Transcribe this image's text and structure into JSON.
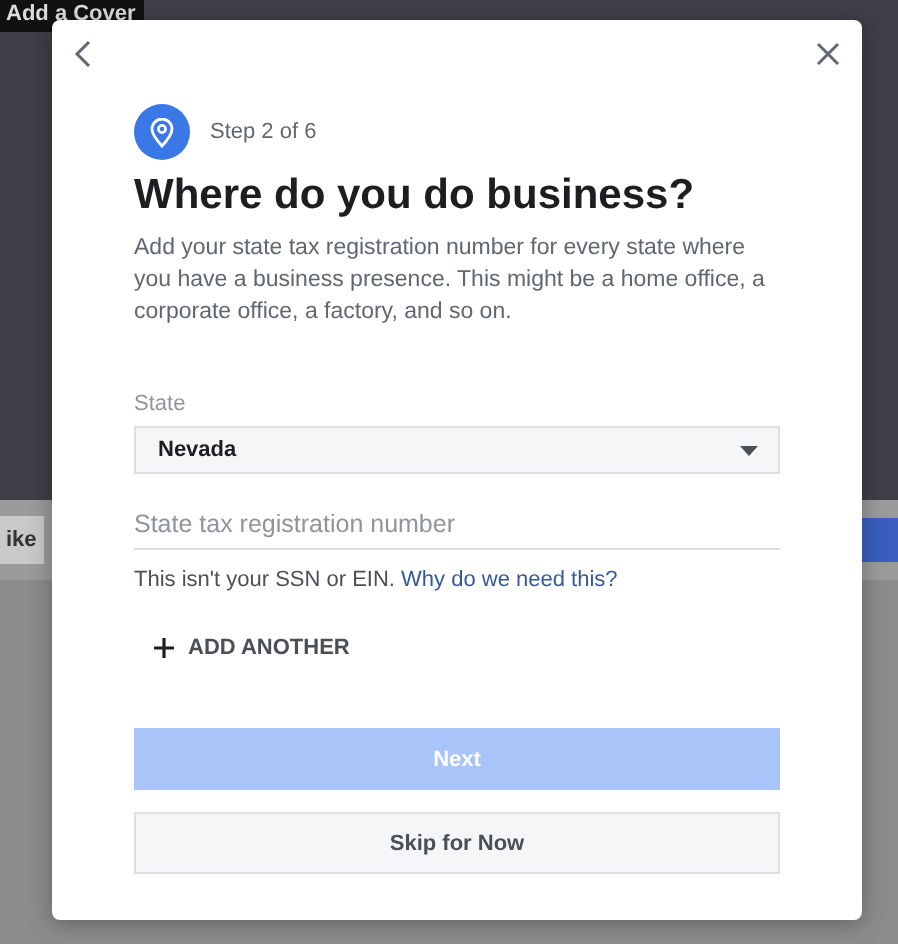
{
  "background": {
    "cover_button": "Add a Cover",
    "side_button": "ike"
  },
  "dialog": {
    "step": "Step 2 of 6",
    "title": "Where do you do business?",
    "description": "Add your state tax registration number for every state where you have a business presence. This might be a home office, a corporate office, a factory, and so on.",
    "state_field": {
      "label": "State",
      "value": "Nevada"
    },
    "tax_field": {
      "placeholder": "State tax registration number"
    },
    "helper": {
      "text": "This isn't your SSN or EIN.",
      "link": "Why do we need this?"
    },
    "add_another": "ADD ANOTHER",
    "next_button": {
      "label": "Next",
      "disabled": true
    },
    "skip_button": "Skip for Now"
  }
}
